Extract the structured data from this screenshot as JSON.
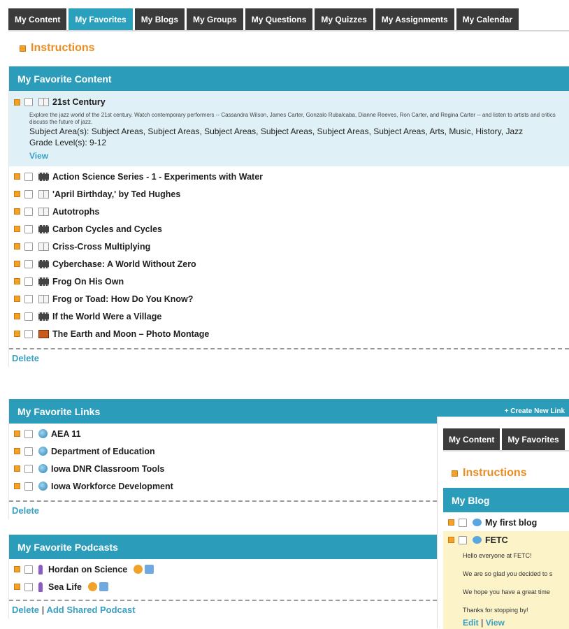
{
  "tabs": [
    "My Content",
    "My Favorites",
    "My Blogs",
    "My Groups",
    "My Questions",
    "My Quizzes",
    "My Assignments",
    "My Calendar"
  ],
  "instructions_label": "Instructions",
  "content": {
    "header": "My Favorite Content",
    "expanded_item": {
      "title": "21st Century",
      "description": "Explore the jazz world of the 21st century. Watch contemporary performers -- Cassandra Wilson, James Carter, Gonzalo Rubalcaba, Dianne Reeves, Ron Carter, and Regina Carter -- and listen to artists and critics discuss the future of jazz.",
      "subject_areas": "Subject Area(s): Subject Areas, Subject Areas, Subject Areas, Subject Areas, Subject Areas, Subject Areas, Arts, Music, History, Jazz",
      "grade_levels": "Grade Level(s): 9-12",
      "view_label": "View"
    },
    "items": [
      {
        "title": "Action Science Series - 1 - Experiments with Water",
        "icon": "film-icon"
      },
      {
        "title": "'April Birthday,' by Ted Hughes",
        "icon": "book-icon"
      },
      {
        "title": "Autotrophs",
        "icon": "book-icon"
      },
      {
        "title": "Carbon Cycles and Cycles",
        "icon": "film-icon"
      },
      {
        "title": "Criss-Cross Multiplying",
        "icon": "book-icon"
      },
      {
        "title": "Cyberchase: A World Without Zero",
        "icon": "film-icon"
      },
      {
        "title": "Frog On His Own",
        "icon": "film-icon"
      },
      {
        "title": "Frog or Toad: How Do You Know?",
        "icon": "book-icon"
      },
      {
        "title": "If the World Were a Village",
        "icon": "film-icon"
      },
      {
        "title": "The Earth and Moon – Photo Montage",
        "icon": "photo-icon"
      }
    ],
    "delete_label": "Delete"
  },
  "links": {
    "header": "My Favorite Links",
    "create_label": "+ Create New Link",
    "items": [
      "AEA 11",
      "Department of Education",
      "Iowa DNR Classroom Tools",
      "Iowa Workforce Development"
    ],
    "delete_label": "Delete"
  },
  "podcasts": {
    "header": "My Favorite Podcasts",
    "items": [
      "Hordan on Science",
      "Sea Life"
    ],
    "delete_label": "Delete",
    "separator": "|",
    "add_label": "Add Shared Podcast"
  },
  "overlay": {
    "tabs": [
      "My Content",
      "My Favorites"
    ],
    "instructions_label": "Instructions",
    "header": "My Blog",
    "items": [
      "My first blog",
      "FETC"
    ],
    "blog_lines": [
      "Hello everyone at FETC!",
      "We are so glad you decided to s",
      "We hope you have a great time",
      "Thanks for stopping by!"
    ],
    "edit_label": "Edit",
    "separator": "|",
    "view_label": "View"
  }
}
